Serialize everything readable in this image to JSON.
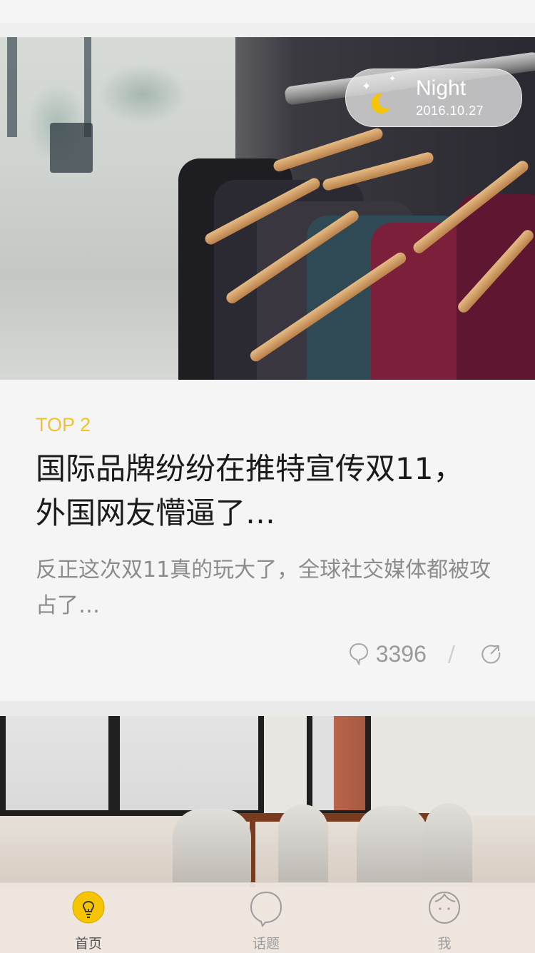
{
  "night_badge": {
    "title": "Night",
    "date": "2016.10.27",
    "moon_icon": "moon-icon",
    "moon_color": "#f6c400"
  },
  "article": {
    "rank": "TOP 2",
    "headline": "国际品牌纷纷在推特宣传双11，外国网友懵逼了…",
    "summary": "反正这次双11真的玩大了，全球社交媒体都被攻占了…",
    "comment_count": "3396",
    "separator": "/",
    "rank_color": "#f2c12e"
  },
  "tabbar": {
    "tabs": [
      {
        "label": "首页",
        "icon": "lightbulb-icon",
        "active": true
      },
      {
        "label": "话题",
        "icon": "chat-bubble-icon",
        "active": false
      },
      {
        "label": "我",
        "icon": "face-icon",
        "active": false
      }
    ],
    "accent": "#f6c400"
  }
}
